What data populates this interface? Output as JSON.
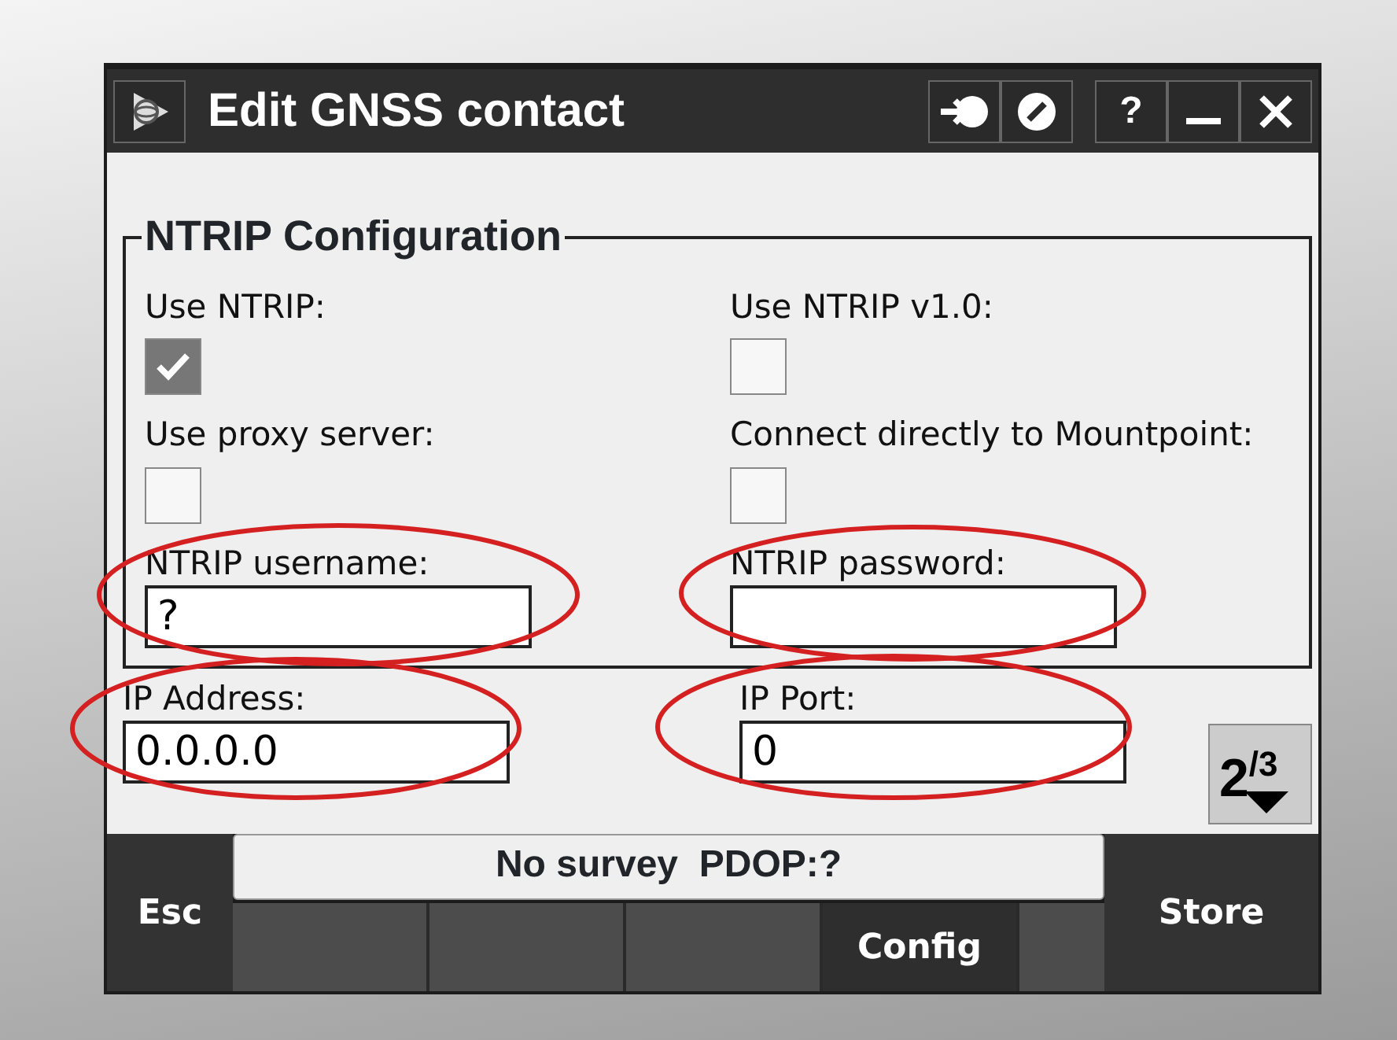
{
  "window": {
    "title": "Edit GNSS contact",
    "help": "?"
  },
  "group": {
    "title": "NTRIP Configuration",
    "fields": [
      {
        "kind": "checkbox",
        "label": "Use NTRIP:",
        "checked": true
      },
      {
        "kind": "checkbox",
        "label": "Use NTRIP v1.0:",
        "checked": false
      },
      {
        "kind": "checkbox",
        "label": "Use proxy server:",
        "checked": false
      },
      {
        "kind": "checkbox",
        "label": "Connect directly to Mountpoint:",
        "checked": false
      },
      {
        "kind": "text",
        "label": "NTRIP username:",
        "value": "?"
      },
      {
        "kind": "text",
        "label": "NTRIP password:"
      }
    ]
  },
  "fields": [
    {
      "kind": "text",
      "label": "IP Address:",
      "value": "0.0.0.0"
    },
    {
      "kind": "text",
      "label": "IP Port:",
      "value": "0"
    }
  ],
  "page": "2$^{/3}$",
  "status": "No survey  PDOP:?",
  "left_key": "Esc",
  "right_key": "Store",
  "softkeys": [
    {
      "kind": "blank"
    },
    {
      "kind": "blank"
    },
    {
      "kind": "blank"
    },
    {
      "kind": "key",
      "label": "Config"
    },
    {
      "kind": "blank"
    }
  ]
}
